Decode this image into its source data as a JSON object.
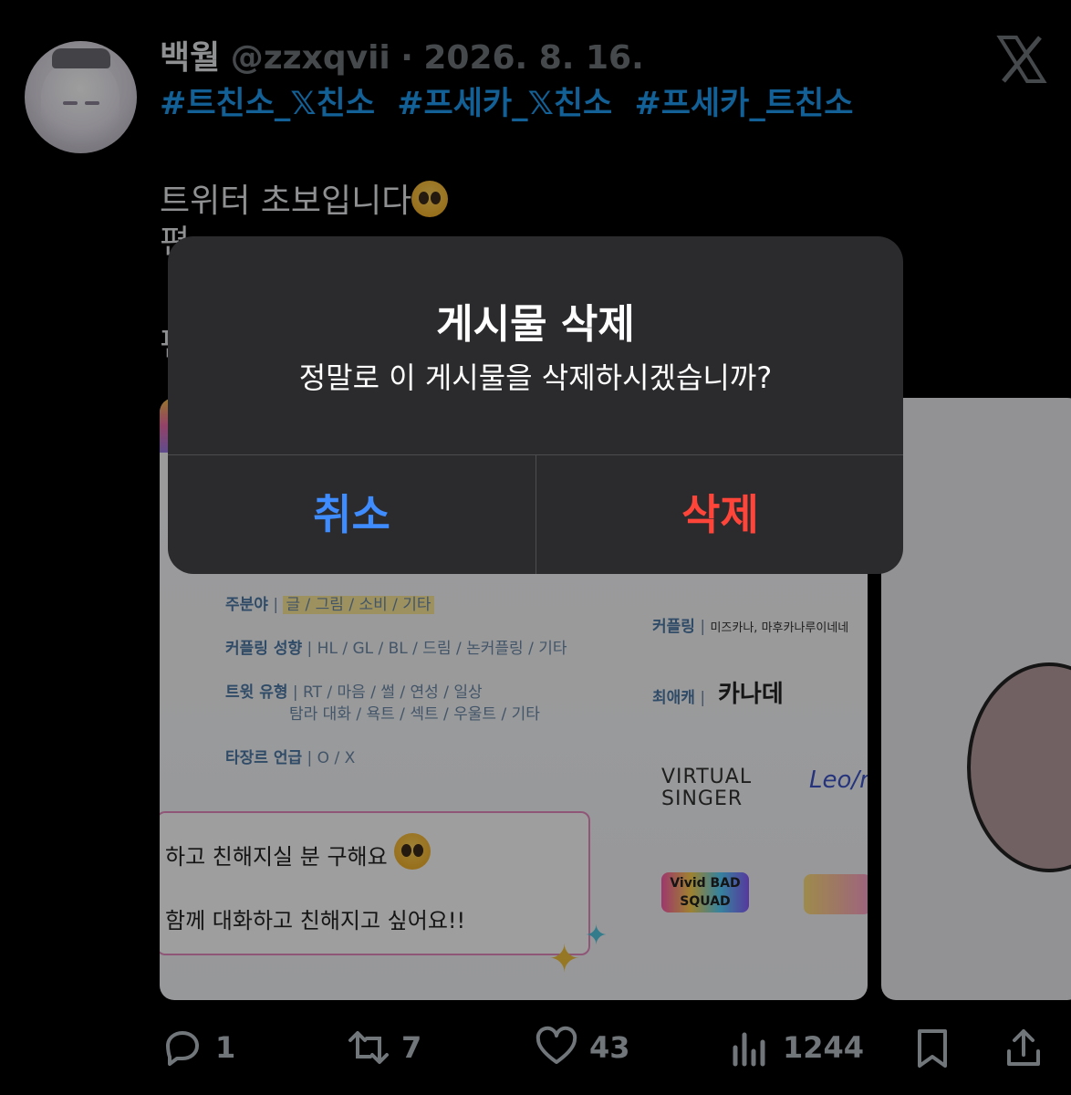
{
  "tweet": {
    "display_name": "백월",
    "handle": "@zzxqvii",
    "separator": "·",
    "date": "2026. 8. 16.",
    "hashtags": [
      "#트친소_𝕏친소",
      "#프세카_𝕏친소",
      "#프세카_트친소"
    ],
    "body_line1": "트위터 초보입니다",
    "body_line2": "편",
    "body_line3": "편"
  },
  "card_image": {
    "rows": [
      {
        "key": "주분야",
        "value": "글 / 그림 / 소비 / 기타"
      },
      {
        "key": "커플링 성향",
        "value": "HL / GL / BL / 드림 / 논커플링 / 기타"
      },
      {
        "key": "트윗 유형",
        "value": "RT / 마음 / 썰 / 연성 / 일상"
      },
      {
        "key": "",
        "value": "탐라 대화 / 욕트 / 섹트 / 우울트 / 기타"
      },
      {
        "key": "타장르 언급",
        "value": "O / X"
      }
    ],
    "right_rows": [
      {
        "key": "커플링",
        "value": "미즈카나, 마후카나루이네네"
      },
      {
        "key": "최애캐",
        "value": "카나데"
      }
    ],
    "units": [
      "VIRTUAL SINGER",
      "Leo/need",
      "Vivid BAD SQUAD"
    ],
    "message_line1": "하고 친해지실 분 구해요",
    "message_line2": "함께 대화하고 친해지고 싶어요!!"
  },
  "dialog": {
    "title": "게시물 삭제",
    "message": "정말로 이 게시물을 삭제하시겠습니까?",
    "cancel": "취소",
    "delete": "삭제"
  },
  "actions": {
    "replies": "1",
    "retweets": "7",
    "likes": "43",
    "views": "1244"
  },
  "colors": {
    "background": "#000000",
    "hashtag": "#1d9bf0",
    "cancel": "#3f8cff",
    "delete": "#ff453a",
    "dialog_bg": "#2b2b2d",
    "muted": "#71767b"
  },
  "icons": [
    "x-logo-icon",
    "reply-icon",
    "retweet-icon",
    "like-icon",
    "views-icon",
    "bookmark-icon",
    "share-icon"
  ]
}
